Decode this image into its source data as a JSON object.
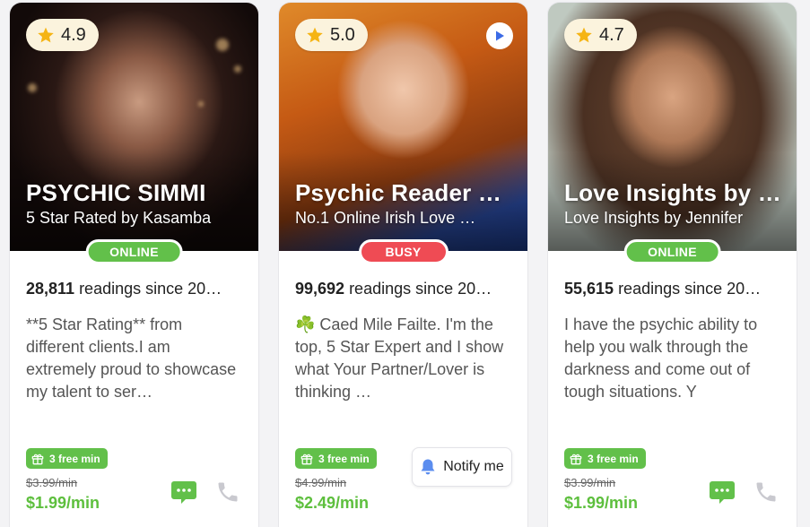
{
  "cards": [
    {
      "rating": "4.9",
      "name": "PSYCHIC SIMMI",
      "subtitle": "5 Star Rated by Kasamba",
      "status": "ONLINE",
      "readings_count": "28,811",
      "readings_text": " readings since 20…",
      "description": "**5 Star Rating** from different clients.I am extremely proud to showcase my talent to ser…",
      "free_label": "3 free min",
      "old_price": "$3.99/min",
      "price": "$1.99/min"
    },
    {
      "rating": "5.0",
      "name": "Psychic Reader …",
      "subtitle": "No.1 Online Irish Love …",
      "status": "BUSY",
      "readings_count": "99,692",
      "readings_text": " readings since 20…",
      "description": "☘️ Caed Mile Failte. I'm the top, 5 Star Expert and I show what Your Partner/Lover is thinking …",
      "free_label": "3 free min",
      "old_price": "$4.99/min",
      "price": "$2.49/min",
      "notify_label": "Notify me"
    },
    {
      "rating": "4.7",
      "name": "Love Insights by …",
      "subtitle": "Love Insights by Jennifer",
      "status": "ONLINE",
      "readings_count": "55,615",
      "readings_text": " readings since 20…",
      "description": "I have the psychic ability to help you walk through the darkness and come out of tough situations. Y",
      "free_label": "3 free min",
      "old_price": "$3.99/min",
      "price": "$1.99/min"
    }
  ],
  "colors": {
    "online": "#62c04a",
    "busy": "#ef4b54",
    "price": "#5dbf3d",
    "rating_bg": "#fbf3dd",
    "star": "#f5b414"
  },
  "icons": [
    "star-icon",
    "play-icon",
    "gift-icon",
    "chat-icon",
    "phone-icon",
    "bell-icon"
  ]
}
